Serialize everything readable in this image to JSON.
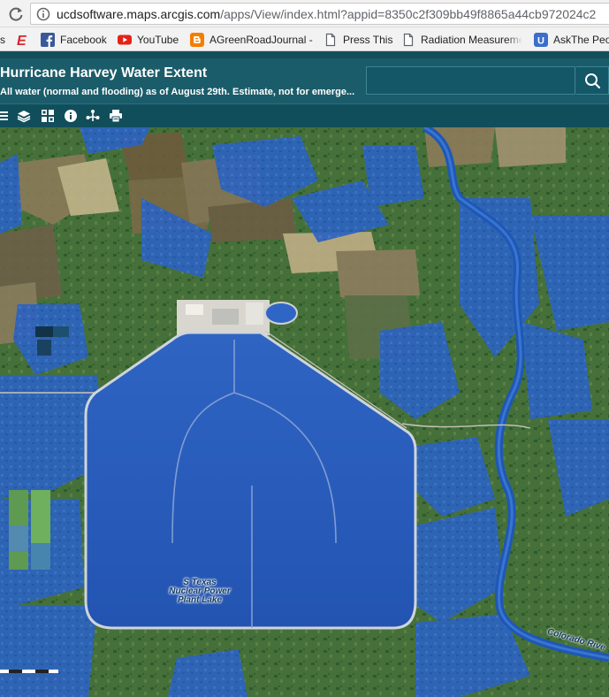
{
  "browser": {
    "url_host": "ucdsoftware.maps.arcgis.com",
    "url_path": "/apps/View/index.html?appid=8350c2f309bb49f8865a44cb972024c2",
    "bookmarks": [
      {
        "label": "s"
      },
      {
        "label": "Facebook"
      },
      {
        "label": "YouTube"
      },
      {
        "label": "AGreenRoadJournal -"
      },
      {
        "label": "Press This"
      },
      {
        "label": "Radiation Measureme"
      },
      {
        "label": "AskThe Peo"
      }
    ]
  },
  "app": {
    "title": "Hurricane Harvey Water Extent",
    "subtitle": "All water (normal and flooding) as of August 29th. Estimate, not for emerge...",
    "search_placeholder": ""
  },
  "toolbar": {
    "icons": [
      "menu-icon",
      "layers-icon",
      "basemap-gallery-icon",
      "about-icon",
      "share-icon",
      "print-icon"
    ]
  },
  "map": {
    "lake_label_1": "S Texas",
    "lake_label_2": "Nuclear Power",
    "lake_label_3": "Plant Lake",
    "river_label": "Colorado Rive"
  },
  "colors": {
    "header": "#1b5c6a",
    "toolbar": "#114e5c",
    "water": "#2b63c2",
    "lake": "#2359b8",
    "vegetation": "#3f6a34"
  }
}
